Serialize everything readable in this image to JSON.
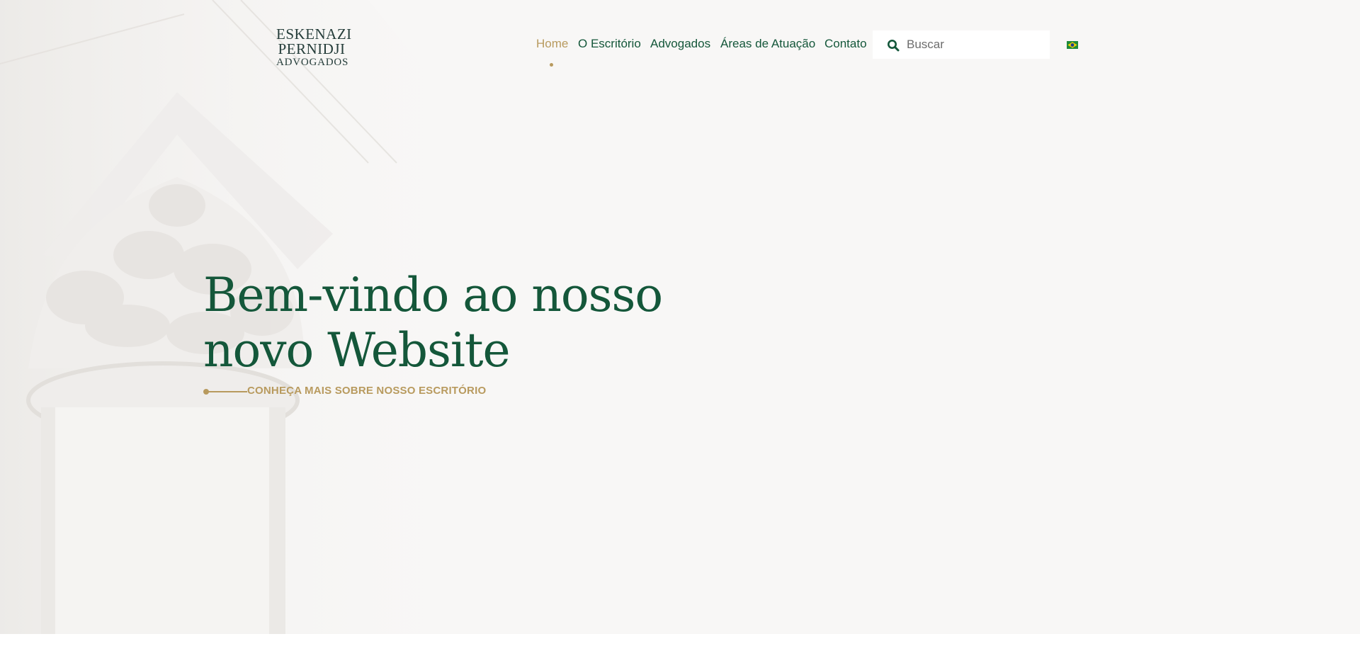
{
  "logo": {
    "line1": "ESKENAZI",
    "line2": "PERNIDJI",
    "line3": "ADVOGADOS"
  },
  "nav": {
    "items": [
      {
        "label": "Home",
        "active": true
      },
      {
        "label": "O Escritório",
        "active": false
      },
      {
        "label": "Advogados",
        "active": false
      },
      {
        "label": "Áreas de Atuação",
        "active": false
      },
      {
        "label": "Contato",
        "active": false
      }
    ]
  },
  "search": {
    "placeholder": "Buscar",
    "value": ""
  },
  "language": {
    "icon": "brazil-flag-icon"
  },
  "hero": {
    "title_line1": "Bem-vindo ao nosso",
    "title_line2": "novo Website",
    "cta_label": "CONHEÇA MAIS SOBRE NOSSO ESCRITÓRIO"
  },
  "colors": {
    "primary_green": "#14573a",
    "accent_gold": "#b89a5e",
    "hero_background": "#f8f7f6"
  }
}
